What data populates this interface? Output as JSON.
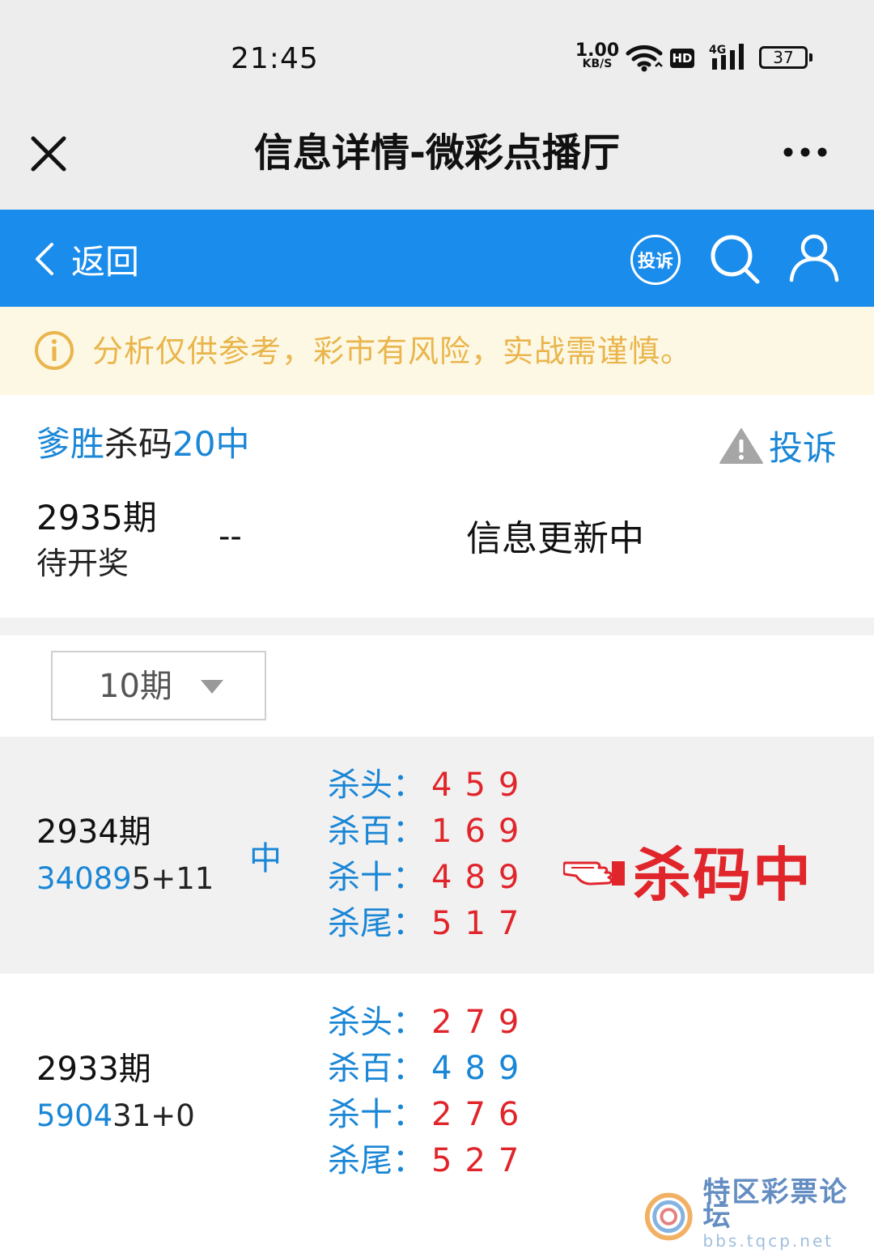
{
  "status_bar": {
    "time": "21:45",
    "net_speed": "1.00",
    "net_speed_unit": "KB/S",
    "hd": "HD",
    "network": "4G",
    "battery": "37"
  },
  "titlebar": {
    "title": "信息详情-微彩点播厅"
  },
  "navbar": {
    "back_label": "返回",
    "complain_badge": "投诉"
  },
  "notice": {
    "text": "分析仅供参考，彩市有风险，实战需谨慎。"
  },
  "author": {
    "name": "爹胜",
    "middle": "杀码",
    "result": "20中",
    "report_label": "投诉"
  },
  "next": {
    "issue": "2935期",
    "status": "待开奖",
    "dash": "--",
    "info": "信息更新中"
  },
  "filter": {
    "selected": "10期"
  },
  "records": [
    {
      "issue": "2934期",
      "draw_prefix": "34089",
      "draw_suffix": "5+11",
      "hit": "中",
      "kills": [
        {
          "label": "杀头：",
          "digits": "459",
          "color": "red"
        },
        {
          "label": "杀百：",
          "digits": "169",
          "color": "red"
        },
        {
          "label": "杀十：",
          "digits": "489",
          "color": "red"
        },
        {
          "label": "杀尾：",
          "digits": "517",
          "color": "red"
        }
      ],
      "stamp": "杀码中"
    },
    {
      "issue": "2933期",
      "draw_prefix": "5904",
      "draw_suffix": "31+0",
      "hit": "",
      "kills": [
        {
          "label": "杀头：",
          "digits": "279",
          "color": "red"
        },
        {
          "label": "杀百：",
          "digits": "489",
          "color": "blue"
        },
        {
          "label": "杀十：",
          "digits": "276",
          "color": "red"
        },
        {
          "label": "杀尾：",
          "digits": "527",
          "color": "red"
        }
      ]
    }
  ],
  "watermark": {
    "name": "特区彩票论坛",
    "url": "bbs.tqcp.net"
  },
  "colors": {
    "nav_blue": "#1a8cec",
    "link_blue": "#1a86d6",
    "hit_red": "#e0252b",
    "notice_bg": "#fdf8e4",
    "notice_text": "#e9b54c"
  }
}
